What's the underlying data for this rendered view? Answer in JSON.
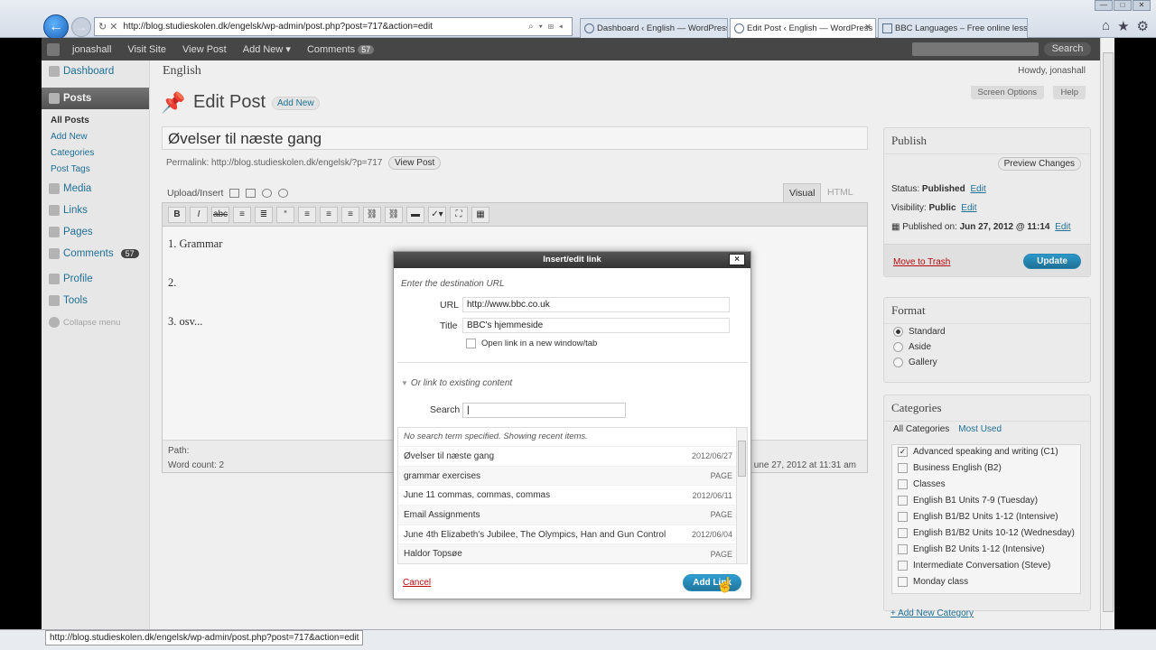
{
  "browser": {
    "address": "http://blog.studieskolen.dk/engelsk/wp-admin/post.php?post=717&action=edit",
    "tabs": [
      {
        "label": "Dashboard ‹ English — WordPress",
        "active": false
      },
      {
        "label": "Edit Post ‹ English — WordPress",
        "active": true
      },
      {
        "label": "BBC Languages – Free online less...",
        "active": false
      }
    ],
    "status_url": "http://blog.studieskolen.dk/engelsk/wp-admin/post.php?post=717&action=edit"
  },
  "adminbar": {
    "user": "jonashall",
    "visit_site": "Visit Site",
    "view_post": "View Post",
    "add_new": "Add New ▾",
    "comments": "Comments",
    "comments_count": "57",
    "search": "Search"
  },
  "sidebar": {
    "dashboard": "Dashboard",
    "posts": "Posts",
    "posts_sub": [
      "All Posts",
      "Add New",
      "Categories",
      "Post Tags"
    ],
    "media": "Media",
    "links": "Links",
    "pages": "Pages",
    "comments": "Comments",
    "comments_count": "57",
    "profile": "Profile",
    "tools": "Tools",
    "collapse": "Collapse menu"
  },
  "header": {
    "site_name": "English",
    "howdy": "Howdy, jonashall",
    "screen_options": "Screen Options",
    "help": "Help",
    "page_title": "Edit Post",
    "add_new": "Add New"
  },
  "post": {
    "title": "Øvelser til næste gang",
    "permalink": "Permalink: http://blog.studieskolen.dk/engelsk/?p=717",
    "view_post": "View Post",
    "upload_insert": "Upload/Insert",
    "tab_visual": "Visual",
    "tab_html": "HTML",
    "body": [
      "1. Grammar",
      "2.",
      "3. osv..."
    ],
    "path": "Path:",
    "word_count": "Word count: 2",
    "last_edited": "une 27, 2012 at 11:31 am"
  },
  "publish": {
    "title": "Publish",
    "preview": "Preview Changes",
    "status_label": "Status:",
    "status_value": "Published",
    "visibility_label": "Visibility:",
    "visibility_value": "Public",
    "published_label": "Published on:",
    "published_value": "Jun 27, 2012 @ 11:14",
    "edit": "Edit",
    "trash": "Move to Trash",
    "update": "Update"
  },
  "format": {
    "title": "Format",
    "options": [
      {
        "label": "Standard",
        "selected": true
      },
      {
        "label": "Aside",
        "selected": false
      },
      {
        "label": "Gallery",
        "selected": false
      }
    ]
  },
  "categories": {
    "title": "Categories",
    "tab_all": "All Categories",
    "tab_most": "Most Used",
    "items": [
      {
        "label": "Advanced speaking and writing (C1)",
        "checked": true
      },
      {
        "label": "Business English (B2)",
        "checked": false
      },
      {
        "label": "Classes",
        "checked": false
      },
      {
        "label": "English B1 Units 7-9 (Tuesday)",
        "checked": false
      },
      {
        "label": "English B1/B2 Units 1-12 (Intensive)",
        "checked": false
      },
      {
        "label": "English B1/B2 Units 10-12 (Wednesday)",
        "checked": false
      },
      {
        "label": "English B2 Units 1-12 (Intensive)",
        "checked": false
      },
      {
        "label": "Intermediate Conversation (Steve)",
        "checked": false
      },
      {
        "label": "Monday class",
        "checked": false
      }
    ],
    "add_new": "+ Add New Category"
  },
  "dialog": {
    "title": "Insert/edit link",
    "close": "×",
    "intro": "Enter the destination URL",
    "url_label": "URL",
    "url_value": "http://www.bbc.co.uk",
    "title_label": "Title",
    "title_value": "BBC's hjemmeside",
    "new_window": "Open link in a new window/tab",
    "existing": "Or link to existing content",
    "search_label": "Search",
    "search_value": "",
    "results_note": "No search term specified. Showing recent items.",
    "results": [
      {
        "title": "Øvelser til næste gang",
        "meta": "2012/06/27"
      },
      {
        "title": "grammar exercises",
        "meta": "PAGE"
      },
      {
        "title": "June 11 commas, commas, commas",
        "meta": "2012/06/11"
      },
      {
        "title": "Email Assignments",
        "meta": "PAGE"
      },
      {
        "title": "June 4th Elizabeth's Jubilee, The Olympics, Han and Gun Control",
        "meta": "2012/06/04"
      },
      {
        "title": "Haldor Topsøe",
        "meta": "PAGE"
      }
    ],
    "cancel": "Cancel",
    "add_link": "Add Link"
  }
}
